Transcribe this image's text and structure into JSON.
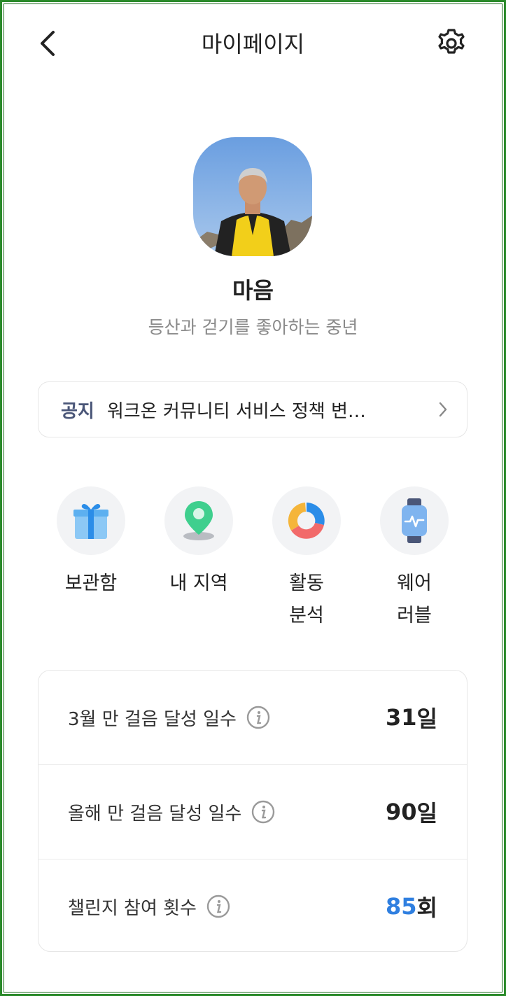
{
  "header": {
    "title": "마이페이지",
    "back_icon": "chevron-left-icon",
    "settings_icon": "gear-icon"
  },
  "profile": {
    "nickname": "마음",
    "bio": "등산과 걷기를 좋아하는 중년"
  },
  "notice": {
    "tag": "공지",
    "text": "워크온 커뮤니티 서비스 정책 변…"
  },
  "menu": [
    {
      "label": "보관함",
      "icon": "gift-box-icon"
    },
    {
      "label": "내 지역",
      "icon": "location-pin-icon"
    },
    {
      "label": "활동\n분석",
      "icon": "donut-chart-icon"
    },
    {
      "label": "웨어\n러블",
      "icon": "smartwatch-icon"
    }
  ],
  "stats": [
    {
      "label": "3월 만 걸음 달성 일수",
      "value": "31",
      "unit": "일"
    },
    {
      "label": "올해 만 걸음 달성 일수",
      "value": "90",
      "unit": "일"
    },
    {
      "label": "챌린지 참여 횟수",
      "value": "85",
      "unit": "회"
    }
  ],
  "colors": {
    "accent_blue": "#2f7fe0",
    "notice_tag": "#4a5678",
    "frame_green": "#2a8a2a"
  }
}
